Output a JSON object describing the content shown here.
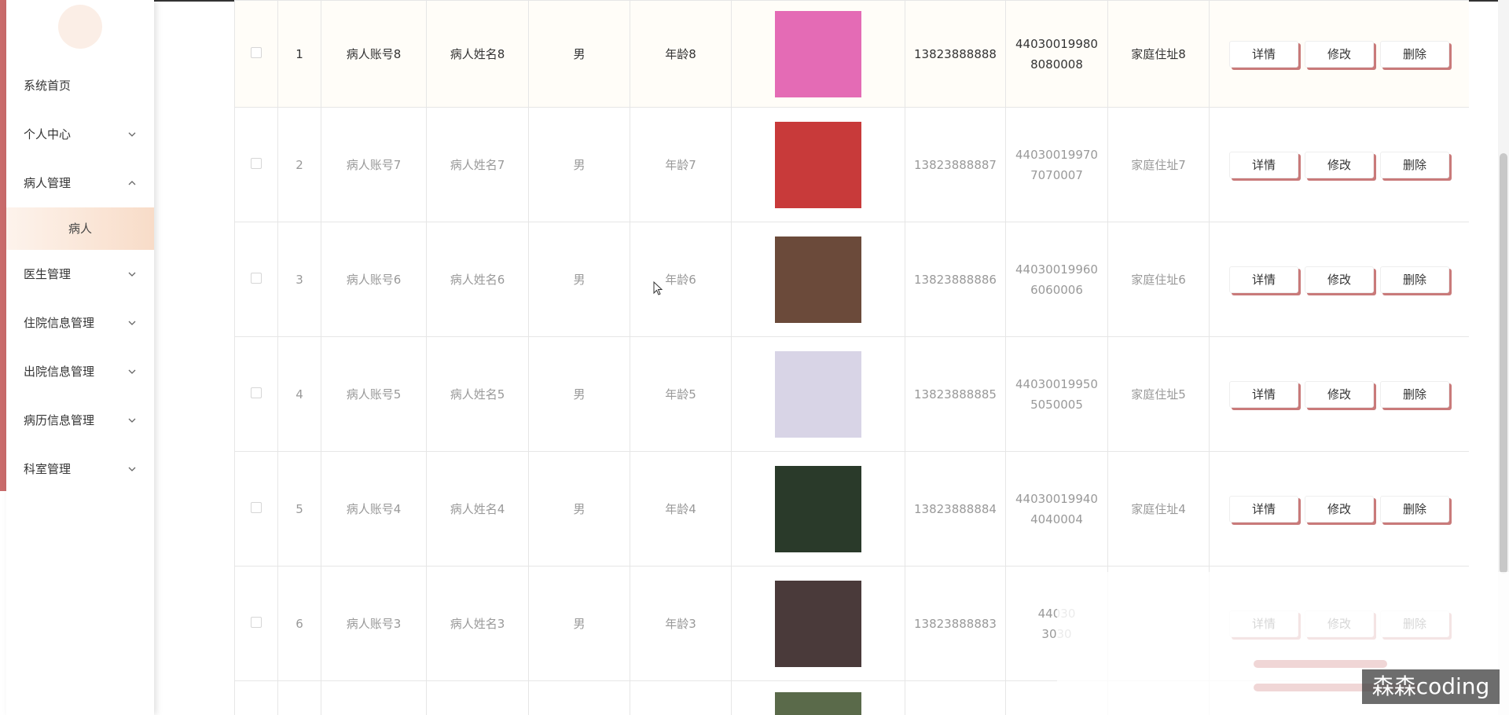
{
  "sidebar": {
    "items": [
      {
        "label": "系统首页",
        "has_chevron": false
      },
      {
        "label": "个人中心",
        "has_chevron": true,
        "chevron": "chevron-down-icon"
      },
      {
        "label": "病人管理",
        "has_chevron": true,
        "chevron": "chevron-up-icon",
        "expanded": true
      },
      {
        "label": "医生管理",
        "has_chevron": true,
        "chevron": "chevron-down-icon"
      },
      {
        "label": "住院信息管理",
        "has_chevron": true,
        "chevron": "chevron-down-icon"
      },
      {
        "label": "出院信息管理",
        "has_chevron": true,
        "chevron": "chevron-down-icon"
      },
      {
        "label": "病历信息管理",
        "has_chevron": true,
        "chevron": "chevron-down-icon"
      },
      {
        "label": "科室管理",
        "has_chevron": true,
        "chevron": "chevron-down-icon"
      }
    ],
    "submenu_active": "病人"
  },
  "buttons": {
    "detail": "详情",
    "edit": "修改",
    "delete": "删除"
  },
  "rows": [
    {
      "index": "1",
      "account": "病人账号8",
      "name": "病人姓名8",
      "gender": "男",
      "age": "年龄8",
      "phone": "13823888888",
      "id_line1": "44030019980",
      "id_line2": "8080008",
      "address": "家庭住址8"
    },
    {
      "index": "2",
      "account": "病人账号7",
      "name": "病人姓名7",
      "gender": "男",
      "age": "年龄7",
      "phone": "13823888887",
      "id_line1": "44030019970",
      "id_line2": "7070007",
      "address": "家庭住址7"
    },
    {
      "index": "3",
      "account": "病人账号6",
      "name": "病人姓名6",
      "gender": "男",
      "age": "年龄6",
      "phone": "13823888886",
      "id_line1": "44030019960",
      "id_line2": "6060006",
      "address": "家庭住址6"
    },
    {
      "index": "4",
      "account": "病人账号5",
      "name": "病人姓名5",
      "gender": "男",
      "age": "年龄5",
      "phone": "13823888885",
      "id_line1": "44030019950",
      "id_line2": "5050005",
      "address": "家庭住址5"
    },
    {
      "index": "5",
      "account": "病人账号4",
      "name": "病人姓名4",
      "gender": "男",
      "age": "年龄4",
      "phone": "13823888884",
      "id_line1": "44030019940",
      "id_line2": "4040004",
      "address": "家庭住址4"
    },
    {
      "index": "6",
      "account": "病人账号3",
      "name": "病人姓名3",
      "gender": "男",
      "age": "年龄3",
      "phone": "13823888883",
      "id_line1": "44030",
      "id_line2": "3030",
      "address": ""
    }
  ],
  "photo_colors": [
    "#e46bb5",
    "#c83a3a",
    "#6b4a3a",
    "#d8d4e6",
    "#2a3a2a",
    "#4a3a3a",
    "#5a6a4a"
  ],
  "watermark": "森森coding",
  "colors": {
    "accent": "#c96b6b",
    "submenu_bg": "#f8dcc8",
    "button_shadow": "#c97a7a"
  }
}
